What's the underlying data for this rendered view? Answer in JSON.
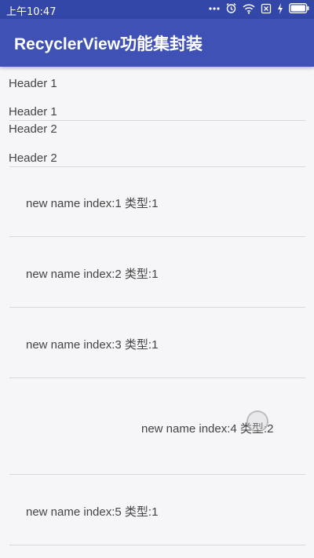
{
  "status_bar": {
    "time": "上午10:47",
    "icons": [
      "more-dots-icon",
      "alarm-icon",
      "wifi-icon",
      "sim-off-icon",
      "charging-icon",
      "battery-icon"
    ]
  },
  "app_bar": {
    "title": "RecyclerView功能集封装",
    "color": "#3f51b5"
  },
  "list": {
    "headers": [
      {
        "top": "Header 1",
        "bottom": "Header 1"
      },
      {
        "top": "Header 2",
        "bottom": "Header 2"
      }
    ],
    "items": [
      {
        "text": "new name   index:1   类型:1"
      },
      {
        "text": "new name   index:2   类型:1"
      },
      {
        "text": "new name   index:3   类型:1"
      },
      {
        "text": "new name   index:4   类型:2"
      },
      {
        "text": "new name   index:5   类型:1"
      }
    ]
  }
}
